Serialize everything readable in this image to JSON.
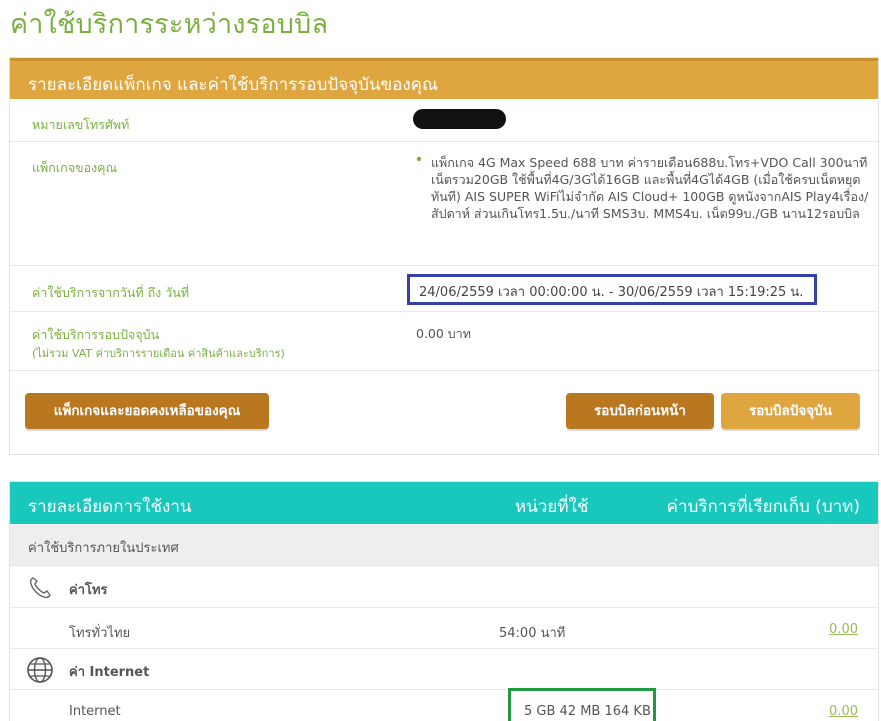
{
  "page": {
    "title": "ค่าใช้บริการระหว่างรอบบิล"
  },
  "package_panel": {
    "header": "รายละเอียดแพ็กเกจ และค่าใช้บริการรอบปัจจุบันของคุณ",
    "rows": {
      "phone": {
        "label": "หมายเลขโทรศัพท์"
      },
      "package": {
        "label": "แพ็กเกจของคุณ",
        "value": "แพ็กเกจ 4G Max Speed 688 บาท ค่ารายเดือน688บ.โทร+VDO Call 300นาที เน็ตรวม20GB ใช้พื้นที่4G/3Gได้16GB และพื้นที่4Gได้4GB (เมื่อใช้ครบเน็ตหยุดทันที) AIS SUPER WiFiไม่จำกัด AIS Cloud+ 100GB ดูหนังจากAIS Play4เรื่อง/สัปดาห์ ส่วนเกินโทร1.5บ./นาที SMS3บ. MMS4บ. เน็ต99บ./GB นาน12รอบบิล"
      },
      "period": {
        "label": "ค่าใช้บริการจากวันที่ ถึง วันที่",
        "value": "24/06/2559 เวลา 00:00:00 น. - 30/06/2559 เวลา 15:19:25 น."
      },
      "current": {
        "label": "ค่าใช้บริการรอบปัจจุบัน",
        "sublabel": "(ไม่รวม VAT ค่าบริการรายเดือน ค่าสินค้าและบริการ)",
        "value": "0.00 บาท"
      }
    },
    "buttons": {
      "package_balance": "แพ็กเกจและยอดคงเหลือของคุณ",
      "previous_bill": "รอบบิลก่อนหน้า",
      "current_bill": "รอบบิลปัจจุบัน"
    }
  },
  "usage_panel": {
    "header": {
      "detail": "รายละเอียดการใช้งาน",
      "units": "หน่วยที่ใช้",
      "fee": "ค่าบริการที่เรียกเก็บ (บาท)"
    },
    "category": "ค่าใช้บริการภายในประเทศ",
    "sections": [
      {
        "label": "ค่าโทร",
        "icon": "phone-icon",
        "items": [
          {
            "label": "โทรทั่วไทย",
            "units": "54:00 นาที",
            "fee": "0.00"
          }
        ]
      },
      {
        "label": "ค่า Internet",
        "icon": "globe-icon",
        "items": [
          {
            "label": "Internet",
            "units": "5 GB 42 MB 164 KB",
            "fee": "0.00"
          }
        ]
      }
    ]
  },
  "colors": {
    "title_green": "#7ab040",
    "gold_header": "#dfa640",
    "dark_gold_button": "#b9771f",
    "teal_header": "#19c8bd",
    "highlight_blue": "#3640a8",
    "highlight_green": "#1f9a3e"
  }
}
